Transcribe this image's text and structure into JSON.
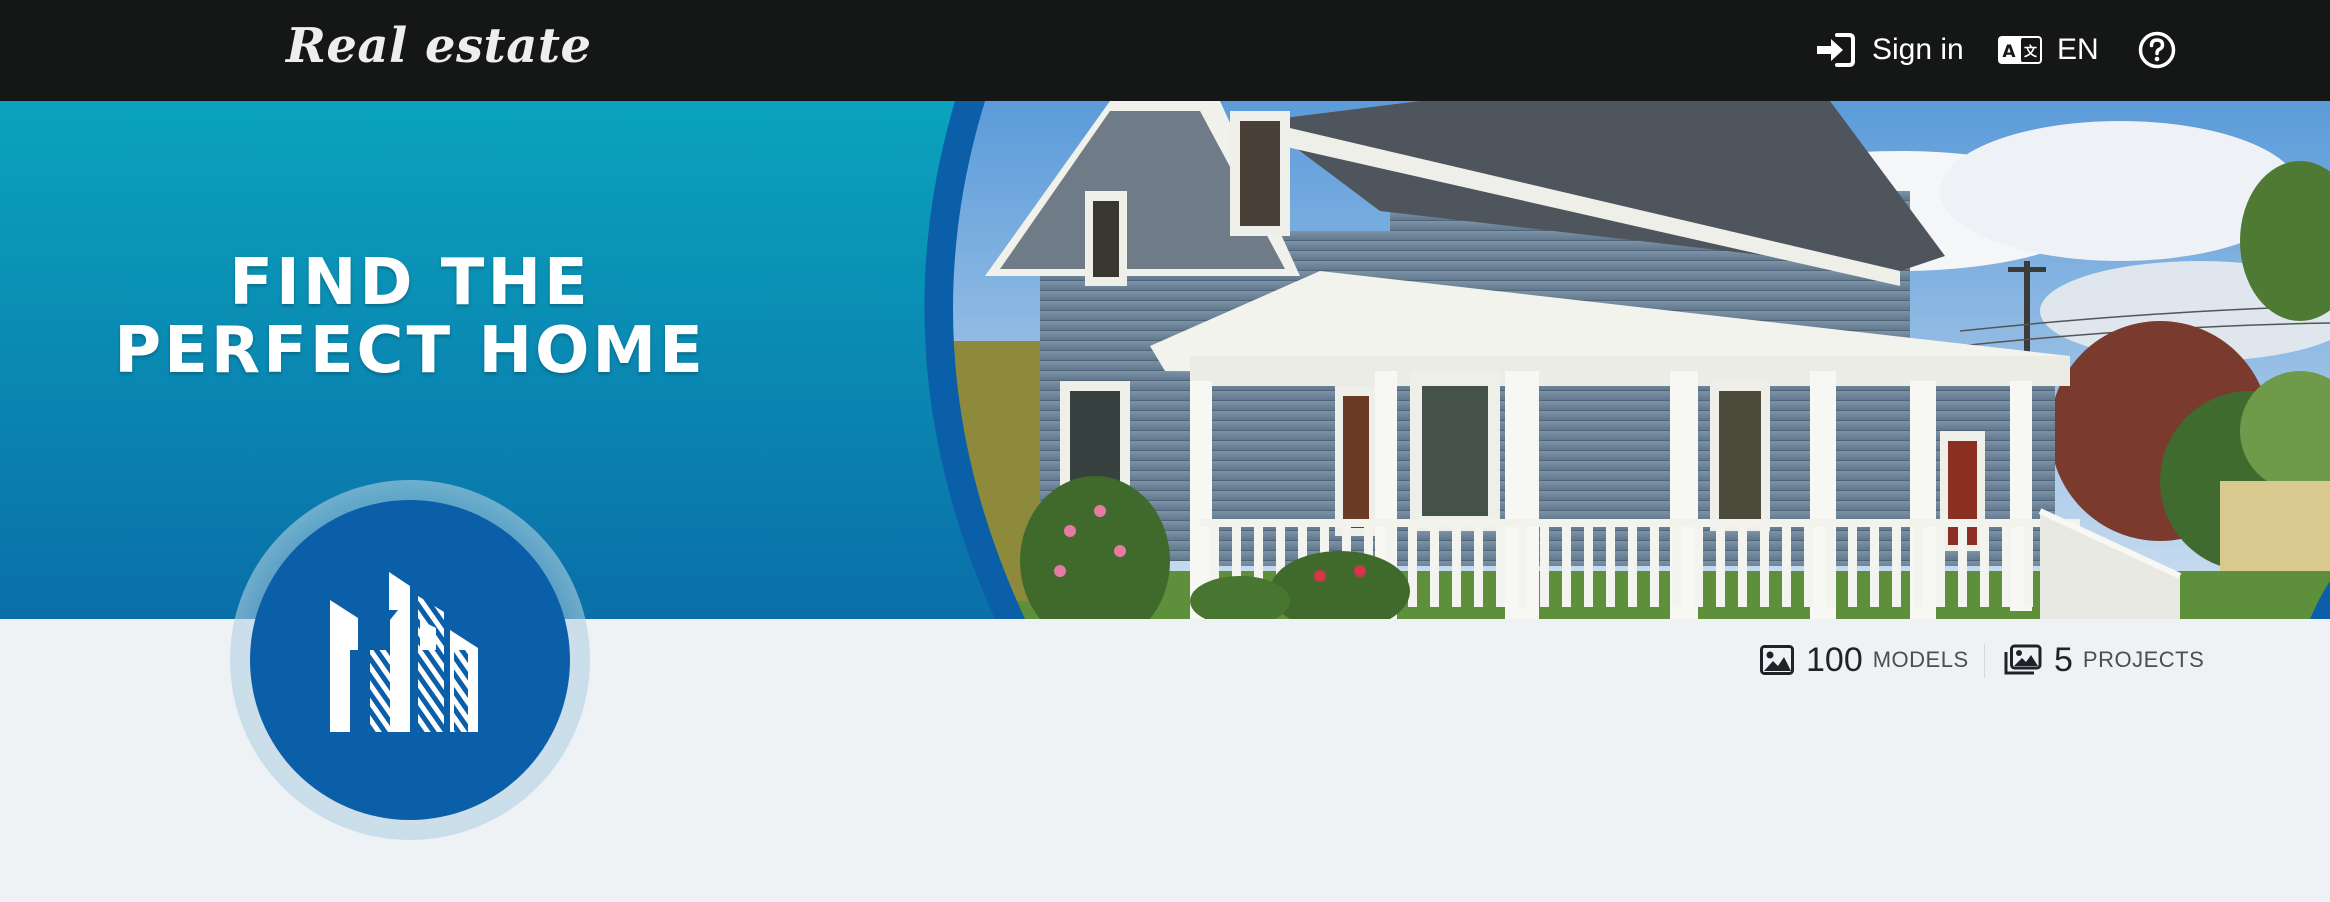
{
  "header": {
    "brand": "Real estate",
    "sign_in": "Sign in",
    "sign_in_icon": "sign-in-icon",
    "language": "EN",
    "language_icon": "translate-icon",
    "help_icon": "question-circle-icon"
  },
  "banner": {
    "headline_line1": "FIND THE",
    "headline_line2": "PERFECT HOME",
    "accent_color": "#0b5ea8",
    "panel_color": "#0a8fb0"
  },
  "stats": {
    "models_count": "100",
    "models_label": "MODELS",
    "models_icon": "image-icon",
    "projects_count": "5",
    "projects_label": "PROJECTS",
    "projects_icon": "images-icon"
  }
}
